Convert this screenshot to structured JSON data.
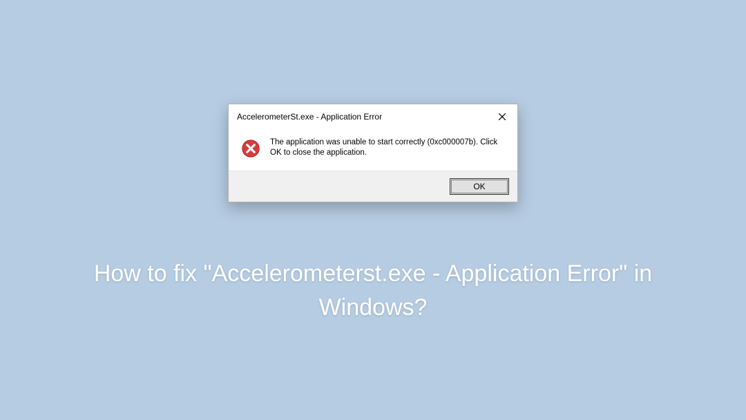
{
  "dialog": {
    "title": "AccelerometerSt.exe - Application Error",
    "message": "The application was unable to start correctly (0xc000007b). Click OK to close the application.",
    "ok_label": "OK"
  },
  "headline": "How to fix \"Accelerometerst.exe - Application Error\" in Windows?"
}
